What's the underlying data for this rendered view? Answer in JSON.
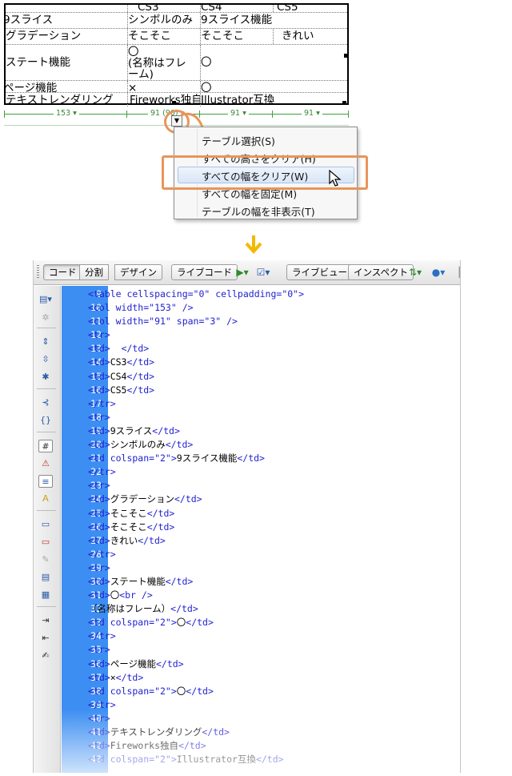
{
  "design_table": {
    "rows": [
      {
        "cells": [
          "",
          "CS3",
          "CS4",
          "CS5"
        ]
      },
      {
        "cells": [
          "9スライス",
          "シンボルのみ",
          "9スライス機能",
          ""
        ]
      },
      {
        "cells": [
          "グラデーション",
          "そこそこ",
          "そこそこ",
          "きれい"
        ]
      },
      {
        "cells": [
          "ステート機能",
          "〇\n(名称はフレ\nーム)",
          "〇",
          ""
        ]
      },
      {
        "cells": [
          "ページ機能",
          "×",
          "〇",
          ""
        ]
      },
      {
        "cells": [
          "テキストレンダリング",
          "Fireworks独自",
          "Illustrator互換",
          ""
        ]
      }
    ],
    "column_widths": [
      "153",
      "91 (90)",
      "91",
      "91"
    ]
  },
  "context_menu": {
    "items": [
      "テーブル選択(S)",
      "すべての高さをクリア(H)",
      "すべての幅をクリア(W)",
      "すべての幅を固定(M)",
      "テーブルの幅を非表示(T)"
    ],
    "highlighted_index": 2
  },
  "toolbar": {
    "view_code": "コード",
    "view_split": "分割",
    "view_design": "デザイン",
    "live_code": "ライブコード",
    "live_view": "ライブビュー",
    "inspect": "インスペクト"
  },
  "colors": {
    "accent_orange": "#e8955a",
    "gutter_blue": "#3c8ef2",
    "guide_green": "#3aa33a",
    "tag_blue": "#1f1fd0",
    "arrow_yellow": "#f5b800"
  },
  "code": {
    "lines": [
      {
        "n": "9",
        "parts": [
          {
            "t": "tag",
            "s": "<table cellspacing=\"0\" cellpadding=\"0\">"
          }
        ]
      },
      {
        "n": "10",
        "parts": [
          {
            "t": "tag",
            "s": "<col width=\"153\" />"
          }
        ]
      },
      {
        "n": "11",
        "parts": [
          {
            "t": "tag",
            "s": "<col width=\"91\" span=\"3\" />"
          }
        ]
      },
      {
        "n": "12",
        "parts": [
          {
            "t": "tag",
            "s": "<tr>"
          }
        ]
      },
      {
        "n": "13",
        "parts": [
          {
            "t": "tag",
            "s": "<td>"
          },
          {
            "t": "txt",
            "s": "  "
          },
          {
            "t": "tag",
            "s": "</td>"
          }
        ]
      },
      {
        "n": "14",
        "parts": [
          {
            "t": "tag",
            "s": "<td>"
          },
          {
            "t": "txt",
            "s": "CS3"
          },
          {
            "t": "tag",
            "s": "</td>"
          }
        ]
      },
      {
        "n": "15",
        "parts": [
          {
            "t": "tag",
            "s": "<td>"
          },
          {
            "t": "txt",
            "s": "CS4"
          },
          {
            "t": "tag",
            "s": "</td>"
          }
        ]
      },
      {
        "n": "16",
        "parts": [
          {
            "t": "tag",
            "s": "<td>"
          },
          {
            "t": "txt",
            "s": "CS5"
          },
          {
            "t": "tag",
            "s": "</td>"
          }
        ]
      },
      {
        "n": "17",
        "parts": [
          {
            "t": "tag",
            "s": "</tr>"
          }
        ]
      },
      {
        "n": "18",
        "parts": [
          {
            "t": "tag",
            "s": "<tr>"
          }
        ]
      },
      {
        "n": "19",
        "parts": [
          {
            "t": "tag",
            "s": "<td>"
          },
          {
            "t": "txt",
            "s": "9スライス"
          },
          {
            "t": "tag",
            "s": "</td>"
          }
        ]
      },
      {
        "n": "20",
        "parts": [
          {
            "t": "tag",
            "s": "<td>"
          },
          {
            "t": "txt",
            "s": "シンボルのみ"
          },
          {
            "t": "tag",
            "s": "</td>"
          }
        ]
      },
      {
        "n": "21",
        "parts": [
          {
            "t": "tag",
            "s": "<td colspan=\"2\">"
          },
          {
            "t": "txt",
            "s": "9スライス機能"
          },
          {
            "t": "tag",
            "s": "</td>"
          }
        ]
      },
      {
        "n": "22",
        "parts": [
          {
            "t": "tag",
            "s": "</tr>"
          }
        ]
      },
      {
        "n": "23",
        "parts": [
          {
            "t": "tag",
            "s": "<tr>"
          }
        ]
      },
      {
        "n": "24",
        "parts": [
          {
            "t": "tag",
            "s": "<td>"
          },
          {
            "t": "txt",
            "s": "グラデーション"
          },
          {
            "t": "tag",
            "s": "</td>"
          }
        ]
      },
      {
        "n": "25",
        "parts": [
          {
            "t": "tag",
            "s": "<td>"
          },
          {
            "t": "txt",
            "s": "そこそこ"
          },
          {
            "t": "tag",
            "s": "</td>"
          }
        ]
      },
      {
        "n": "26",
        "parts": [
          {
            "t": "tag",
            "s": "<td>"
          },
          {
            "t": "txt",
            "s": "そこそこ"
          },
          {
            "t": "tag",
            "s": "</td>"
          }
        ]
      },
      {
        "n": "27",
        "parts": [
          {
            "t": "tag",
            "s": "<td>"
          },
          {
            "t": "txt",
            "s": "きれい"
          },
          {
            "t": "tag",
            "s": "</td>"
          }
        ]
      },
      {
        "n": "28",
        "parts": [
          {
            "t": "tag",
            "s": "</tr>"
          }
        ]
      },
      {
        "n": "29",
        "parts": [
          {
            "t": "tag",
            "s": "<tr>"
          }
        ]
      },
      {
        "n": "30",
        "parts": [
          {
            "t": "tag",
            "s": "<td>"
          },
          {
            "t": "txt",
            "s": "ステート機能"
          },
          {
            "t": "tag",
            "s": "</td>"
          }
        ]
      },
      {
        "n": "31",
        "parts": [
          {
            "t": "tag",
            "s": "<td>"
          },
          {
            "t": "txt",
            "s": "〇"
          },
          {
            "t": "tag",
            "s": "<br />"
          }
        ]
      },
      {
        "n": "32",
        "parts": [
          {
            "t": "txt",
            "s": "（名称はフレーム）"
          },
          {
            "t": "tag",
            "s": "</td>"
          }
        ]
      },
      {
        "n": "33",
        "parts": [
          {
            "t": "tag",
            "s": "<td colspan=\"2\">"
          },
          {
            "t": "txt",
            "s": "〇"
          },
          {
            "t": "tag",
            "s": "</td>"
          }
        ]
      },
      {
        "n": "34",
        "parts": [
          {
            "t": "tag",
            "s": "</tr>"
          }
        ]
      },
      {
        "n": "35",
        "parts": [
          {
            "t": "tag",
            "s": "<tr>"
          }
        ]
      },
      {
        "n": "36",
        "parts": [
          {
            "t": "tag",
            "s": "<td>"
          },
          {
            "t": "txt",
            "s": "ページ機能"
          },
          {
            "t": "tag",
            "s": "</td>"
          }
        ]
      },
      {
        "n": "37",
        "parts": [
          {
            "t": "tag",
            "s": "<td>"
          },
          {
            "t": "txt",
            "s": "×"
          },
          {
            "t": "tag",
            "s": "</td>"
          }
        ]
      },
      {
        "n": "38",
        "parts": [
          {
            "t": "tag",
            "s": "<td colspan=\"2\">"
          },
          {
            "t": "txt",
            "s": "〇"
          },
          {
            "t": "tag",
            "s": "</td>"
          }
        ]
      },
      {
        "n": "39",
        "parts": [
          {
            "t": "tag",
            "s": "</tr>"
          }
        ]
      },
      {
        "n": "40",
        "parts": [
          {
            "t": "tag",
            "s": "<tr>"
          }
        ]
      },
      {
        "n": "41",
        "parts": [
          {
            "t": "tag",
            "s": "<td>"
          },
          {
            "t": "txt",
            "s": "テキストレンダリング"
          },
          {
            "t": "tag",
            "s": "</td>"
          }
        ]
      },
      {
        "n": "42",
        "parts": [
          {
            "t": "tag",
            "s": "<td>"
          },
          {
            "t": "txt",
            "s": "Fireworks独自"
          },
          {
            "t": "tag",
            "s": "</td>"
          }
        ]
      },
      {
        "n": "43",
        "parts": [
          {
            "t": "tag",
            "s": "<td colspan=\"2\">"
          },
          {
            "t": "txt",
            "s": "Illustrator互換"
          },
          {
            "t": "tag",
            "s": "</td>"
          }
        ]
      }
    ]
  }
}
